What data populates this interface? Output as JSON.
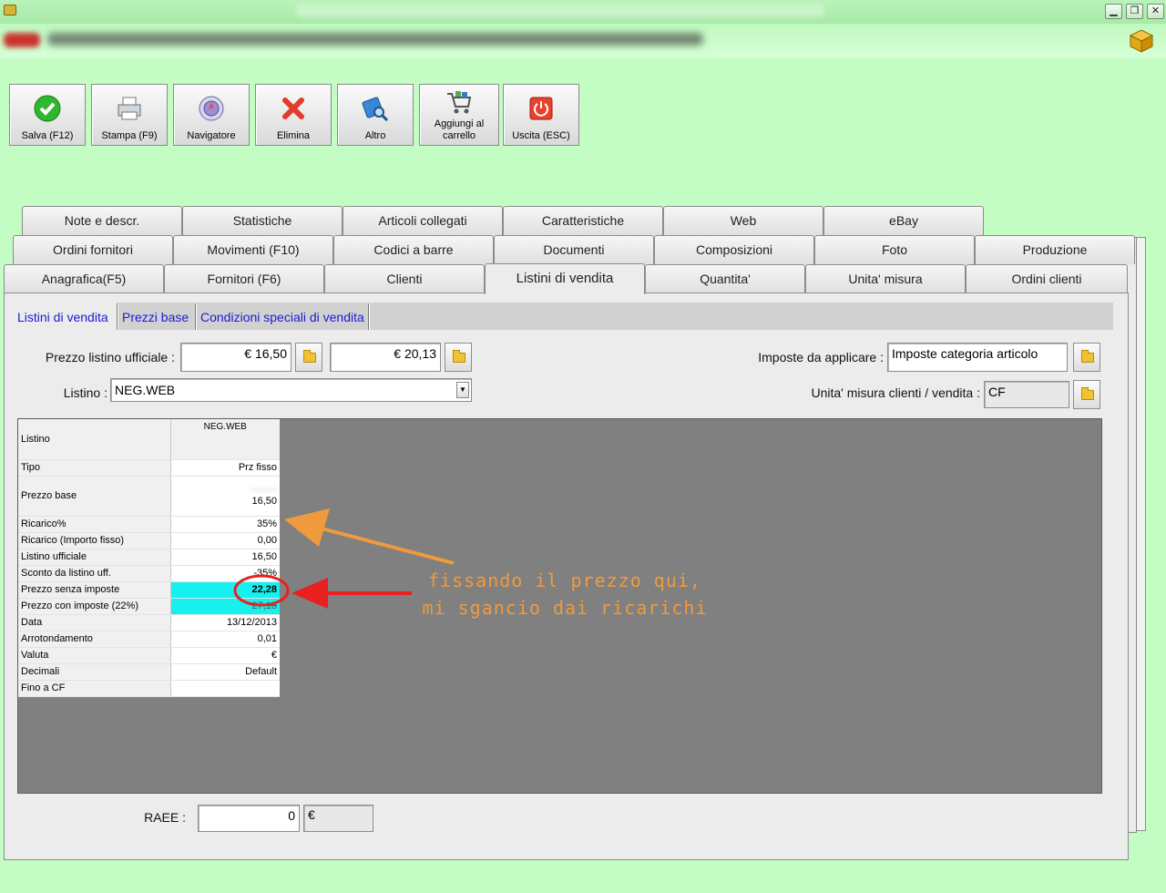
{
  "toolbar": {
    "save": "Salva (F12)",
    "print": "Stampa (F9)",
    "navigator": "Navigatore",
    "delete": "Elimina",
    "other": "Altro",
    "cart_line1": "Aggiungi al",
    "cart_line2": "carrello",
    "exit": "Uscita (ESC)"
  },
  "tabs": {
    "row1": [
      "Note e descr.",
      "Statistiche",
      "Articoli collegati",
      "Caratteristiche",
      "Web",
      "eBay"
    ],
    "row2": [
      "Ordini fornitori",
      "Movimenti (F10)",
      "Codici a barre",
      "Documenti",
      "Composizioni",
      "Foto",
      "Produzione"
    ],
    "row3": [
      "Anagrafica(F5)",
      "Fornitori (F6)",
      "Clienti",
      "Listini di vendita",
      "Quantita'",
      "Unita' misura",
      "Ordini clienti"
    ]
  },
  "subtabs": [
    "Listini di vendita",
    "Prezzi base",
    "Condizioni speciali di vendita"
  ],
  "form": {
    "official_price_label": "Prezzo listino ufficiale :",
    "official_price_1": "€ 16,50",
    "official_price_2": "€ 20,13",
    "tax_label": "Imposte da applicare :",
    "tax_value": "Imposte categoria articolo",
    "listino_label": "Listino :",
    "listino_value": "NEG.WEB",
    "unit_label": "Unita' misura clienti / vendita :",
    "unit_value": "CF",
    "raee_label": "RAEE :",
    "raee_value": "0",
    "raee_currency": "€"
  },
  "grid": {
    "header_label": "Listino",
    "column": "NEG.WEB",
    "rows": [
      {
        "label": "Tipo",
        "value": "Prz fisso"
      },
      {
        "label": "Prezzo base",
        "value": "16,50"
      },
      {
        "label": "Ricarico%",
        "value": "35%"
      },
      {
        "label": "Ricarico (Importo fisso)",
        "value": "0,00"
      },
      {
        "label": "Listino ufficiale",
        "value": "16,50"
      },
      {
        "label": "Sconto da listino uff.",
        "value": "-35%"
      },
      {
        "label": "Prezzo senza imposte",
        "value": "22,28"
      },
      {
        "label": "Prezzo con imposte (22%)",
        "value": "27,18"
      },
      {
        "label": "Data",
        "value": "13/12/2013"
      },
      {
        "label": "Arrotondamento",
        "value": "0,01"
      },
      {
        "label": "Valuta",
        "value": "€"
      },
      {
        "label": "Decimali",
        "value": "Default"
      },
      {
        "label": "Fino a CF",
        "value": ""
      }
    ]
  },
  "annotation": {
    "line1": "fissando il prezzo qui,",
    "line2": "mi sgancio dai ricarichi"
  },
  "colors": {
    "background": "#c3fdc3",
    "highlight_cell": "#16f0ee",
    "annotation_orange": "#f09a3e",
    "annotation_red": "#e8201e"
  }
}
